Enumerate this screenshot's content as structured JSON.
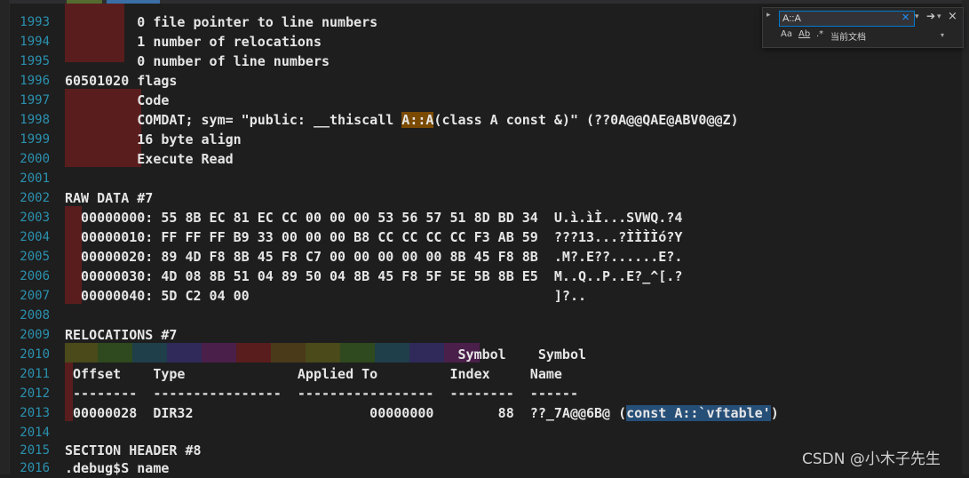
{
  "find": {
    "query": "A::A",
    "option_case": "Aa",
    "option_word": "Ab",
    "option_regex": ".*",
    "scope": "当前文档"
  },
  "lines": [
    {
      "num": "1993",
      "text": "         0 file pointer to line numbers"
    },
    {
      "num": "1994",
      "text": "         1 number of relocations"
    },
    {
      "num": "1995",
      "text": "         0 number of line numbers"
    },
    {
      "num": "1996",
      "text": "60501020 flags"
    },
    {
      "num": "1997",
      "text": "         Code"
    },
    {
      "num": "1998",
      "text": "         COMDAT; sym= \"public: __thiscall ",
      "find": "A::A",
      "after": "(class A const &)\" (??0A@@QAE@ABV0@@Z)"
    },
    {
      "num": "1999",
      "text": "         16 byte align"
    },
    {
      "num": "2000",
      "text": "         Execute Read"
    },
    {
      "num": "2001",
      "text": ""
    },
    {
      "num": "2002",
      "text": "RAW DATA #7"
    },
    {
      "num": "2003",
      "text": "  00000000: 55 8B EC 81 EC CC 00 00 00 53 56 57 51 8D BD 34  U.ì.ìÌ...SVWQ.?4"
    },
    {
      "num": "2004",
      "text": "  00000010: FF FF FF B9 33 00 00 00 B8 CC CC CC CC F3 AB 59  ???13...?ÌÌÌÌó?Y"
    },
    {
      "num": "2005",
      "text": "  00000020: 89 4D F8 8B 45 F8 C7 00 00 00 00 00 8B 45 F8 8B  .M?.E??......E?."
    },
    {
      "num": "2006",
      "text": "  00000030: 4D 08 8B 51 04 89 50 04 8B 45 F8 5F 5E 5B 8B E5  M..Q..P..E?_^[.?"
    },
    {
      "num": "2007",
      "text": "  00000040: 5D C2 04 00                                      ]?.."
    },
    {
      "num": "2008",
      "text": ""
    },
    {
      "num": "2009",
      "text": "RELOCATIONS #7"
    },
    {
      "num": "2010",
      "text": "                                                 Symbol    Symbol"
    },
    {
      "num": "2011",
      "text": " Offset    Type              Applied To         Index     Name"
    },
    {
      "num": "2012",
      "text": " --------  ----------------  -----------------  --------  ------"
    },
    {
      "num": "2013",
      "text": " 00000028  DIR32                      00000000        88  ??_7A@@6B@ (",
      "sel": "const A::`vftable'",
      "after": ")"
    },
    {
      "num": "2014",
      "text": ""
    },
    {
      "num": "2015",
      "text": "SECTION HEADER #8"
    },
    {
      "num": "2016",
      "text": ".debug$S name"
    }
  ],
  "watermark": "CSDN @小木子先生",
  "colors": {
    "background": "#1e1e1e",
    "line_number": "#2b91af",
    "find_highlight": "#7a4a00",
    "selection": "#264f78",
    "red_block": "#5a1d1d"
  }
}
